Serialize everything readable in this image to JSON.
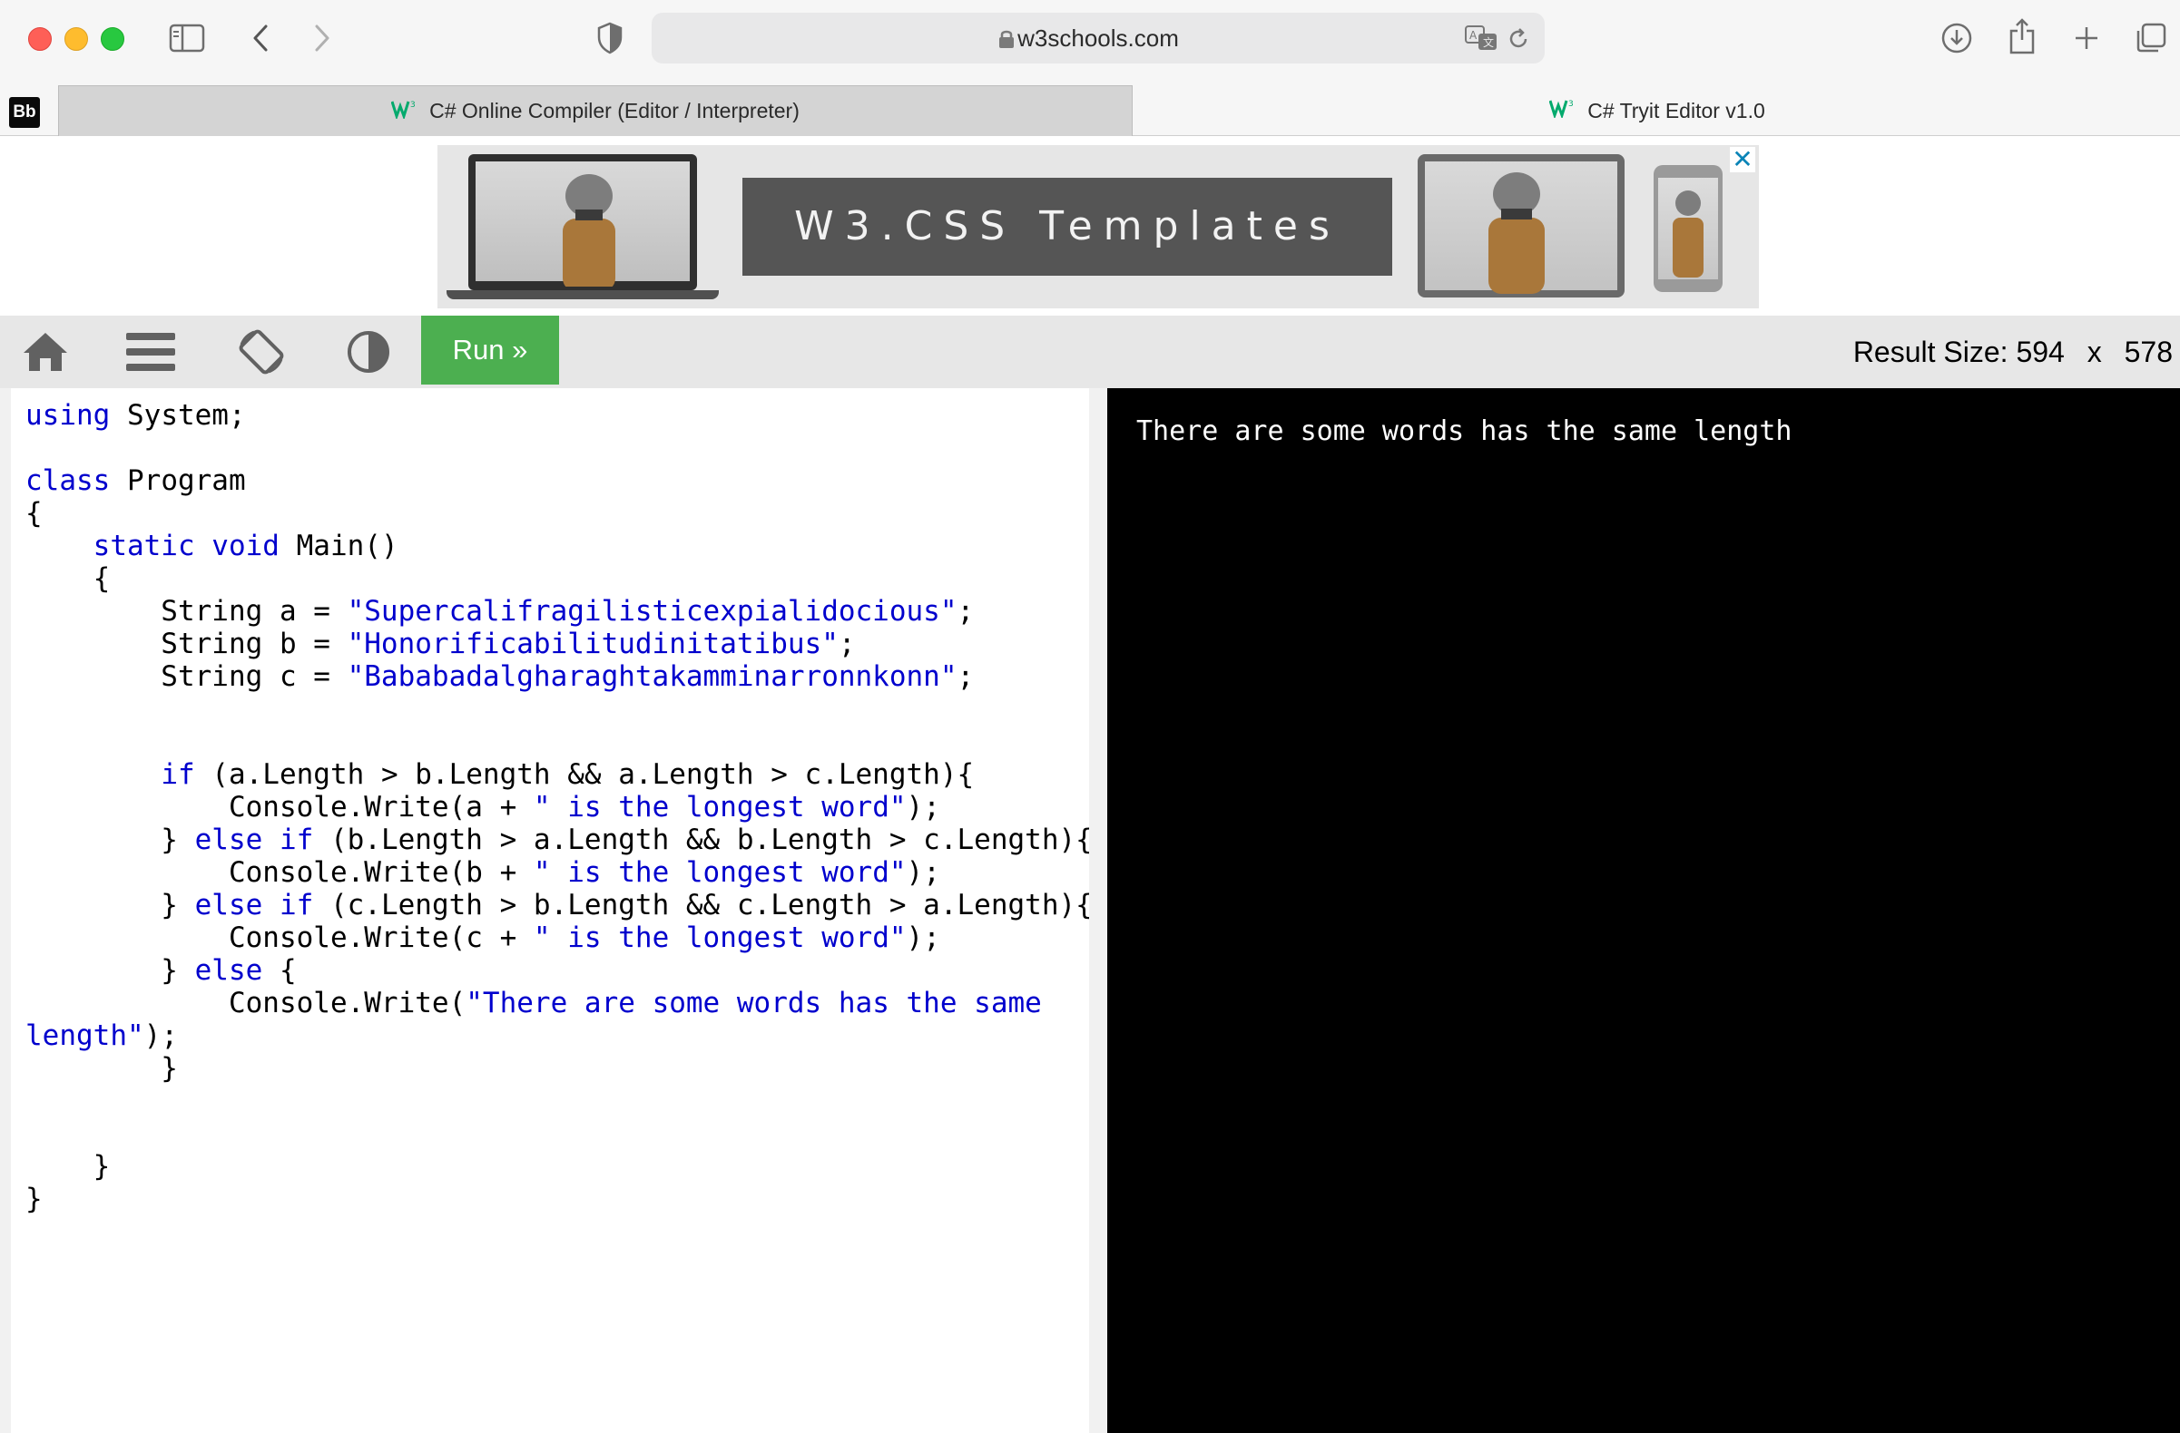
{
  "browser": {
    "url": "w3schools.com",
    "tabs": [
      {
        "label": "C# Online Compiler (Editor / Interpreter)",
        "active": true
      },
      {
        "label": "C# Tryit Editor v1.0",
        "active": false
      }
    ],
    "bookmark_label": "Bb"
  },
  "ad": {
    "banner_text": "W3.CSS Templates",
    "close_label": "✕"
  },
  "toolbar": {
    "run_label": "Run »",
    "result_size_label": "Result Size:",
    "result_width": "594",
    "result_x": "x",
    "result_height": "578"
  },
  "editor": {
    "lines": [
      [
        [
          "kw",
          "using"
        ],
        [
          "txt",
          " System;"
        ]
      ],
      [],
      [
        [
          "kw",
          "class"
        ],
        [
          "txt",
          " Program"
        ]
      ],
      [
        [
          "txt",
          "{"
        ]
      ],
      [
        [
          "txt",
          "    "
        ],
        [
          "kw",
          "static void"
        ],
        [
          "txt",
          " Main()"
        ]
      ],
      [
        [
          "txt",
          "    {"
        ]
      ],
      [
        [
          "txt",
          "        String a = "
        ],
        [
          "str",
          "\"Supercalifragilisticexpialidocious\""
        ],
        [
          "txt",
          ";"
        ]
      ],
      [
        [
          "txt",
          "        String b = "
        ],
        [
          "str",
          "\"Honorificabilitudinitatibus\""
        ],
        [
          "txt",
          ";"
        ]
      ],
      [
        [
          "txt",
          "        String c = "
        ],
        [
          "str",
          "\"Bababadalgharaghtakamminarronnkonn\""
        ],
        [
          "txt",
          ";"
        ]
      ],
      [],
      [],
      [
        [
          "txt",
          "        "
        ],
        [
          "kw",
          "if"
        ],
        [
          "txt",
          " (a.Length > b.Length && a.Length > c.Length){"
        ]
      ],
      [
        [
          "txt",
          "            Console.Write(a + "
        ],
        [
          "str",
          "\" is the longest word\""
        ],
        [
          "txt",
          ");"
        ]
      ],
      [
        [
          "txt",
          "        } "
        ],
        [
          "kw",
          "else if"
        ],
        [
          "txt",
          " (b.Length > a.Length && b.Length > c.Length){"
        ]
      ],
      [
        [
          "txt",
          "            Console.Write(b + "
        ],
        [
          "str",
          "\" is the longest word\""
        ],
        [
          "txt",
          ");"
        ]
      ],
      [
        [
          "txt",
          "        } "
        ],
        [
          "kw",
          "else if"
        ],
        [
          "txt",
          " (c.Length > b.Length && c.Length > a.Length){"
        ]
      ],
      [
        [
          "txt",
          "            Console.Write(c + "
        ],
        [
          "str",
          "\" is the longest word\""
        ],
        [
          "txt",
          ");"
        ]
      ],
      [
        [
          "txt",
          "        } "
        ],
        [
          "kw",
          "else"
        ],
        [
          "txt",
          " {"
        ]
      ],
      [
        [
          "txt",
          "            Console.Write("
        ],
        [
          "str",
          "\"There are some words has the same"
        ]
      ],
      [
        [
          "str",
          "length\""
        ],
        [
          "txt",
          ");"
        ]
      ],
      [
        [
          "txt",
          "        }"
        ]
      ],
      [],
      [],
      [
        [
          "txt",
          "    }"
        ]
      ],
      [
        [
          "txt",
          "}"
        ]
      ]
    ]
  },
  "console": {
    "output": "There are some words has the same length"
  },
  "colors": {
    "run_button": "#4caf50",
    "keyword": "#0000cd",
    "console_bg": "#000000"
  },
  "icons": [
    "sidebar-icon",
    "back-icon",
    "forward-icon",
    "shield-icon",
    "lock-icon",
    "translate-icon",
    "reload-icon",
    "download-icon",
    "share-icon",
    "new-tab-icon",
    "tabs-overview-icon",
    "home-icon",
    "menu-icon",
    "rotate-icon",
    "contrast-icon",
    "close-icon"
  ]
}
